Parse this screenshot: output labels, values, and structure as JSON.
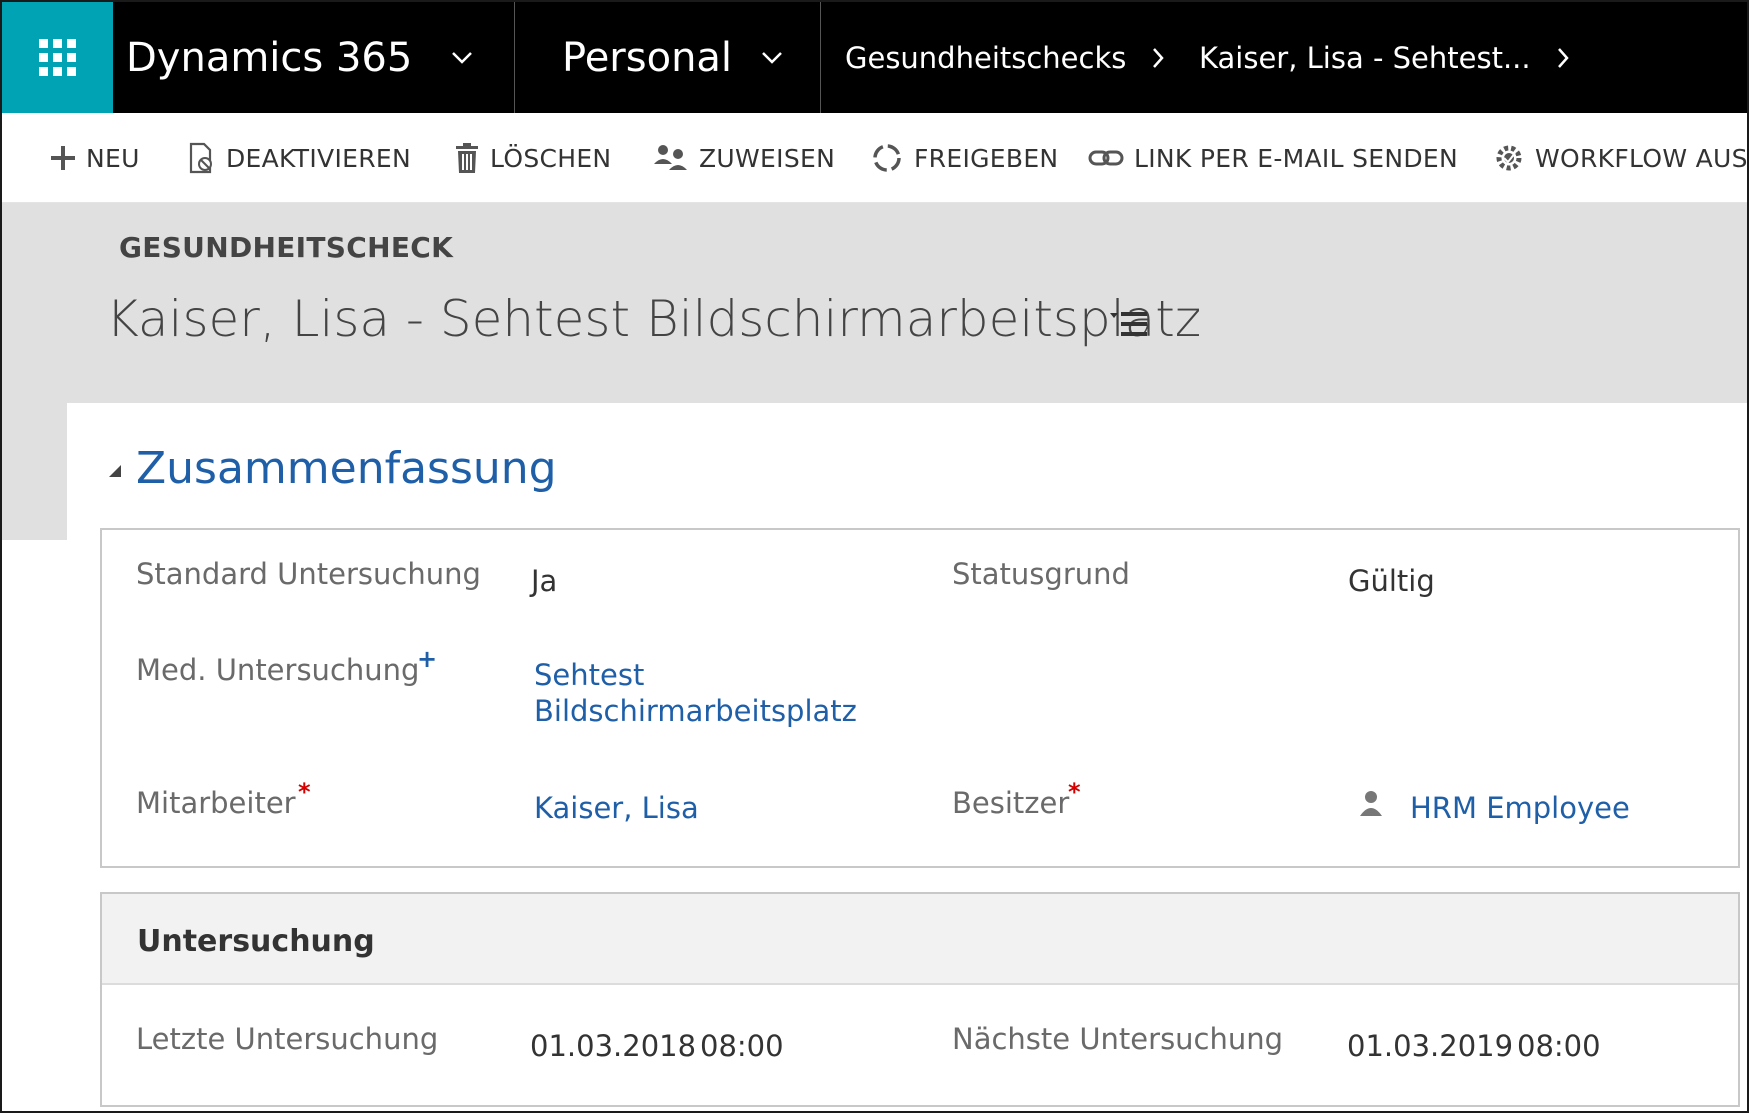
{
  "nav": {
    "app_name": "Dynamics 365",
    "area": "Personal",
    "breadcrumb_entity": "Gesundheitschecks",
    "breadcrumb_record": "Kaiser, Lisa  - Sehtest..."
  },
  "commands": {
    "new": "NEU",
    "deactivate": "DEAKTIVIEREN",
    "delete": "LÖSCHEN",
    "assign": "ZUWEISEN",
    "share": "FREIGEBEN",
    "email_link": "LINK PER E-MAIL SENDEN",
    "workflow": "WORKFLOW AUSFÜHREN"
  },
  "header": {
    "entity_label": "GESUNDHEITSCHECK",
    "record_title": "Kaiser, Lisa  - Sehtest Bildschirmarbeitsplatz"
  },
  "summary": {
    "section_title": "Zusammenfassung",
    "standard_label": "Standard Untersuchung",
    "standard_value": "Ja",
    "status_reason_label": "Statusgrund",
    "status_reason_value": "Gültig",
    "med_label": "Med. Untersuchung",
    "med_value_line1": "Sehtest",
    "med_value_line2": "Bildschirmarbeitsplatz",
    "employee_label": "Mitarbeiter",
    "employee_value": "Kaiser, Lisa",
    "owner_label": "Besitzer",
    "owner_value": "HRM Employee",
    "required_mark": "*",
    "recommended_mark": "+"
  },
  "exam": {
    "section_title": "Untersuchung",
    "last_label": "Letzte Untersuchung",
    "last_date": "01.03.2018",
    "last_time": "08:00",
    "next_label": "Nächste Untersuchung",
    "next_date": "01.03.2019",
    "next_time": "08:00"
  },
  "colors": {
    "accent": "#00a3b4",
    "link": "#1f5fa8",
    "required": "#d40000"
  }
}
